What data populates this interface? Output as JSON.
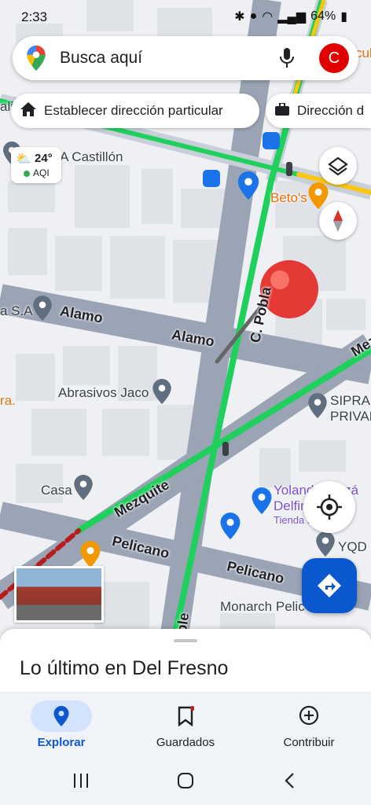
{
  "status_bar": {
    "time": "2:33",
    "battery": "64%"
  },
  "search": {
    "placeholder": "Busca aquí",
    "avatar_letter": "C"
  },
  "chips": {
    "home": "Establecer dirección particular",
    "work": "Dirección d"
  },
  "weather": {
    "temp": "24°",
    "aqi": "AQI"
  },
  "map_labels": {
    "castillon": "AJERIA Castillón",
    "betos": "Beto's",
    "sa": "a S.A",
    "alamo1": "Alamo",
    "alamo2": "Alamo",
    "poblano": "C. Pobla",
    "abrasivos": "Abrasivos Jaco",
    "ra": "ra.",
    "sipra1": "SIPRA",
    "sipra2": "PRIVAD",
    "casa": "Casa",
    "mezquite": "Mezquite",
    "yolanda1": "Yolanda Pinzá",
    "yolanda2": "Delfin CV",
    "yolanda3": "Tienda idad",
    "pelicano1": "Pelicano",
    "pelicano2": "Pelicano",
    "yqd": "YQD",
    "monarch": "Monarch Pelic",
    "ble": "ble",
    "mez": "Mez",
    "cul": "culo",
    "ali": "ali"
  },
  "sheet": {
    "title": "Lo último en Del Fresno"
  },
  "bottom_nav": {
    "explore": "Explorar",
    "saved": "Guardados",
    "contribute": "Contribuir"
  },
  "colors": {
    "accent": "#0b57d0",
    "pin": "#e53935",
    "traffic": "#1fd15c"
  }
}
